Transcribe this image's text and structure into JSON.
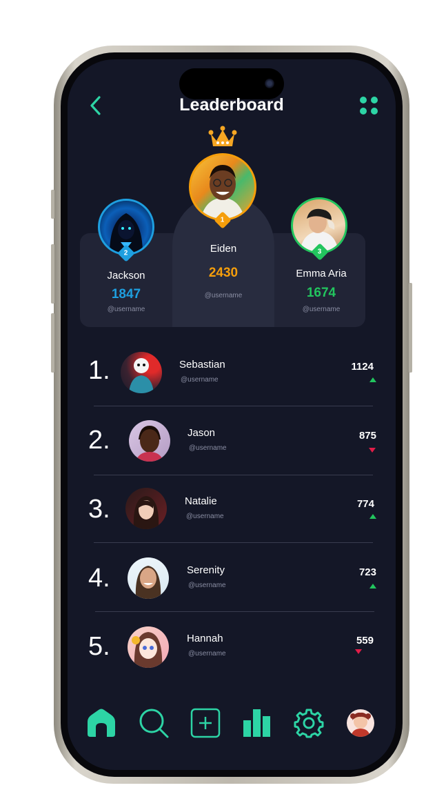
{
  "header": {
    "title": "Leaderboard"
  },
  "podium": [
    {
      "rank": "2",
      "name": "Jackson",
      "score": "1847",
      "username": "@username",
      "color": "#1e9fe0"
    },
    {
      "rank": "1",
      "name": "Eiden",
      "score": "2430",
      "username": "@username",
      "color": "#f59e0b"
    },
    {
      "rank": "3",
      "name": "Emma Aria",
      "score": "1674",
      "username": "@username",
      "color": "#22c55e"
    }
  ],
  "list": [
    {
      "rank": "1.",
      "name": "Sebastian",
      "username": "@username",
      "score": "1124",
      "trend": "up"
    },
    {
      "rank": "2.",
      "name": "Jason",
      "username": "@username",
      "score": "875",
      "trend": "down"
    },
    {
      "rank": "3.",
      "name": "Natalie",
      "username": "@username",
      "score": "774",
      "trend": "up"
    },
    {
      "rank": "4.",
      "name": "Serenity",
      "username": "@username",
      "score": "723",
      "trend": "up"
    },
    {
      "rank": "5.",
      "name": "Hannah",
      "username": "@username",
      "score": "559",
      "trend": "down"
    }
  ],
  "nav": [
    "home-icon",
    "search-icon",
    "add-icon",
    "stats-icon",
    "settings-icon",
    "profile-avatar"
  ],
  "colors": {
    "accent": "#2dd4a5",
    "background": "#141727",
    "gold": "#f59e0b",
    "blue": "#1e9fe0",
    "green": "#22c55e",
    "up": "#22c55e",
    "down": "#e11d48"
  }
}
